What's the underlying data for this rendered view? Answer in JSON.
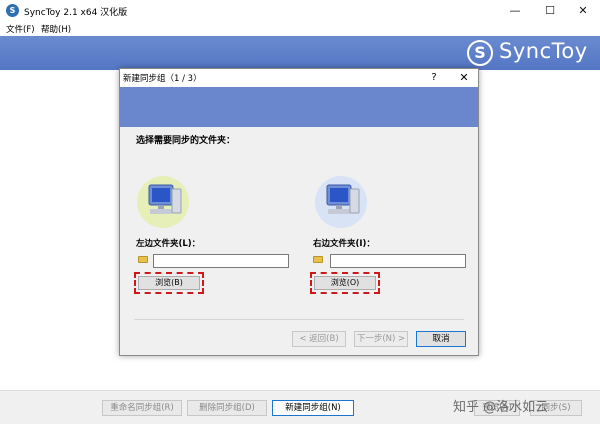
{
  "window": {
    "title": "SyncToy 2.1 x64 汉化版",
    "minimize": "—",
    "maximize": "☐",
    "close": "✕"
  },
  "menu": [
    {
      "label": "文件(F)"
    },
    {
      "label": "帮助(H)"
    }
  ],
  "logo": {
    "text": "SyncToy",
    "glyph": "S"
  },
  "bottom_buttons": {
    "rename": "重命名同步组(R)",
    "delete": "删除同步组(D)",
    "new": "新建同步组(N)",
    "preview": "预览(A)",
    "run": "同步(S)"
  },
  "watermark": "知乎 @洛水如云",
  "dialog": {
    "title": "新建同步组（1 / 3）",
    "help": "?",
    "close": "✕",
    "heading": "选择需要同步的文件夹：",
    "left": {
      "label": "左边文件夹(L)：",
      "value": "",
      "browse": "浏览(B)"
    },
    "right": {
      "label": "右边文件夹(I)：",
      "value": "",
      "browse": "浏览(O)"
    },
    "back": "< 返回(B)",
    "next": "下一步(N) >",
    "cancel": "取消"
  },
  "colors": {
    "header_band": "#5f7fca",
    "highlight": "#cc1a1a",
    "focus_border": "#1976d2"
  }
}
